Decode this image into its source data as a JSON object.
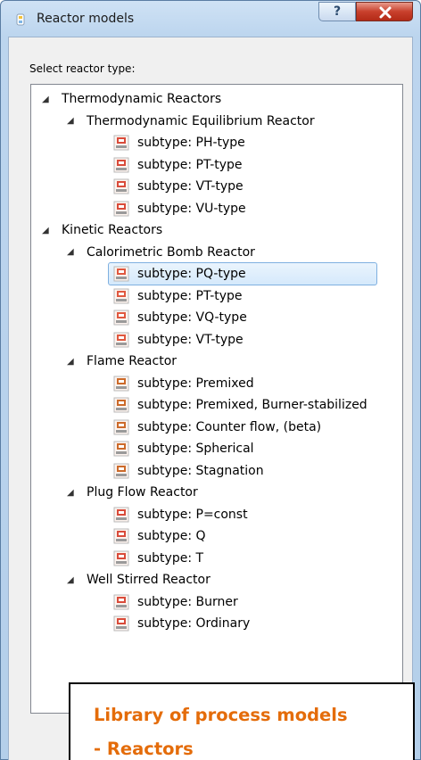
{
  "window": {
    "title": "Reactor models",
    "help_label": "?",
    "close_label": "✕",
    "icon": "reactor-app-icon"
  },
  "dialog": {
    "prompt": "Select reactor type:"
  },
  "tree": {
    "groups": [
      {
        "label": "Thermodynamic Reactors",
        "children": [
          {
            "label": "Thermodynamic Equilibrium Reactor",
            "leaves": [
              "subtype: PH-type",
              "subtype: PT-type",
              "subtype: VT-type",
              "subtype: VU-type"
            ]
          }
        ]
      },
      {
        "label": "Kinetic Reactors",
        "children": [
          {
            "label": "Calorimetric Bomb Reactor",
            "leaves": [
              "subtype: PQ-type",
              "subtype: PT-type",
              "subtype: VQ-type",
              "subtype: VT-type"
            ]
          },
          {
            "label": "Flame Reactor",
            "leaves": [
              "subtype: Premixed",
              "subtype: Premixed, Burner-stabilized",
              "subtype: Counter flow, (beta)",
              "subtype: Spherical",
              "subtype: Stagnation"
            ]
          },
          {
            "label": "Plug Flow Reactor",
            "leaves": [
              "subtype: P=const",
              "subtype: Q",
              "subtype: T"
            ]
          },
          {
            "label": "Well Stirred Reactor",
            "leaves": [
              "subtype: Burner",
              "subtype: Ordinary"
            ]
          }
        ]
      }
    ],
    "selected": "subtype: PQ-type",
    "expand_glyph": "◢"
  },
  "callout": {
    "line1": "Library of process models",
    "line2": "- Reactors"
  },
  "colors": {
    "callout_text": "#e46c0a",
    "selection": "#d5e9fb"
  }
}
